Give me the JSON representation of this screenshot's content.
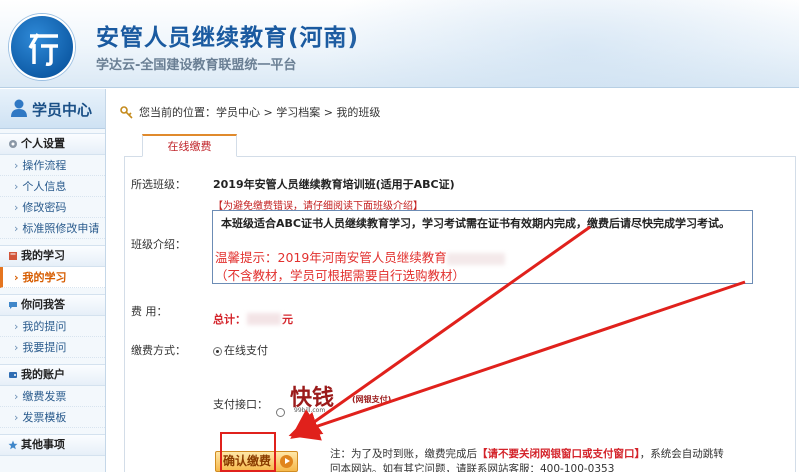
{
  "header": {
    "title": "安管人员继续教育(河南)",
    "subtitle": "学达云-全国建设教育联盟统一平台"
  },
  "sidebar": {
    "title": "学员中心",
    "groups": [
      {
        "label": "个人设置",
        "items": [
          "操作流程",
          "个人信息",
          "修改密码",
          "标准照修改申请"
        ]
      },
      {
        "label": "我的学习",
        "items": [
          "我的学习"
        ]
      },
      {
        "label": "你问我答",
        "items": [
          "我的提问",
          "我要提问"
        ]
      },
      {
        "label": "我的账户",
        "items": [
          "缴费发票",
          "发票模板"
        ]
      },
      {
        "label": "其他事项",
        "items": []
      }
    ],
    "active_item": "我的学习"
  },
  "breadcrumb": "您当前的位置：学员中心 > 学习档案 > 我的班级",
  "tab": {
    "label": "在线缴费"
  },
  "form": {
    "class_label": "所选班级：",
    "class_value": "2019年安管人员继续教育培训班(适用于ABC证)",
    "tip": "【为避免缴费错误，请仔细阅读下面班级介绍】",
    "intro_label": "班级介绍：",
    "intro_line": "本班级适合ABC证书人员继续教育学习，学习考试需在证书有效期内完成，缴费后请尽快完成学习考试。",
    "warm_prefix": "温馨提示：2019年河南安管人员继续教育",
    "warm_suffix": "（不含教材，学员可根据需要自行选购教材）",
    "fee_label": "费    用：",
    "total_prefix": "总计：",
    "total_suffix": "元",
    "pay_method_label": "缴费方式：",
    "pay_method_option": "在线支付",
    "pay_gateway_label": "支付接口：",
    "gateway_logo_text": "快钱",
    "gateway_logo_small": "99bill.com",
    "gateway_logo_tag": "(网银支付)",
    "confirm_button": "确认缴费",
    "note_line1_a": "注：为了及时到账，缴费完成后",
    "note_line1_red": "【请不要关闭网银窗口或支付窗口】",
    "note_line1_b": "，系统会自动跳转",
    "note_line2": "回本网站。如有其它问题，请联系网站客服：400-100-0353"
  },
  "colors": {
    "brand": "#1a5aa0",
    "accent_red": "#d4232a",
    "button": "#f6b84a"
  }
}
